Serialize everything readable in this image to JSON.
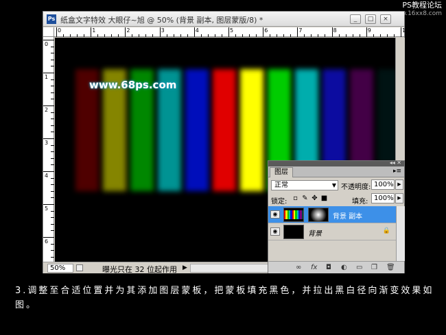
{
  "site_watermark": {
    "title": "PS教程论坛",
    "url": "www.16xx8.com"
  },
  "window": {
    "title": "纸盒文字特效 大眼仔~旭 @ 50% (背景 副本, 图层蒙版/8) *",
    "ps_logo": "Ps",
    "buttons": {
      "minimize": "_",
      "restore": "□",
      "close": "×"
    }
  },
  "ruler": {
    "h_labels": [
      "0",
      "1",
      "2",
      "3",
      "4",
      "5",
      "6",
      "7",
      "8",
      "9",
      "10"
    ],
    "v_labels": [
      "0",
      "1",
      "2",
      "3",
      "4",
      "5",
      "6"
    ]
  },
  "canvas": {
    "watermark": "www.68ps.com",
    "bars": [
      "#e10000",
      "#f2f200",
      "#00c000",
      "#00b8b8",
      "#0010d0",
      "#e00000",
      "#ffff00",
      "#00cc00",
      "#00c0c0",
      "#1010c8",
      "#7a0080",
      "#004040"
    ],
    "bars_fade": [
      0.35,
      0.55,
      0.7,
      0.8,
      0.9,
      1,
      1,
      1,
      0.9,
      0.8,
      0.55,
      0.3
    ]
  },
  "status": {
    "zoom": "50%",
    "info": "曝光只在 32 位起作用",
    "arrow": "▶"
  },
  "layers_panel": {
    "tab": "图层",
    "menu_icons": "◂◂ ✕",
    "blend_mode": "正常",
    "opacity_label": "不透明度:",
    "opacity_value": "100%",
    "lock_label": "锁定:",
    "fill_label": "填充:",
    "fill_value": "100%",
    "layers": [
      {
        "name": "背景 副本",
        "active": true
      },
      {
        "name": "背景",
        "active": false
      }
    ],
    "bottom_icons": [
      "link-icon",
      "fx-icon",
      "mask-icon",
      "adjustment-icon",
      "folder-icon",
      "new-layer-icon",
      "trash-icon"
    ]
  },
  "caption": "3.调整至合适位置并为其添加图层蒙板，把蒙板填充黑色，并拉出黑白径向渐变效果如图。"
}
